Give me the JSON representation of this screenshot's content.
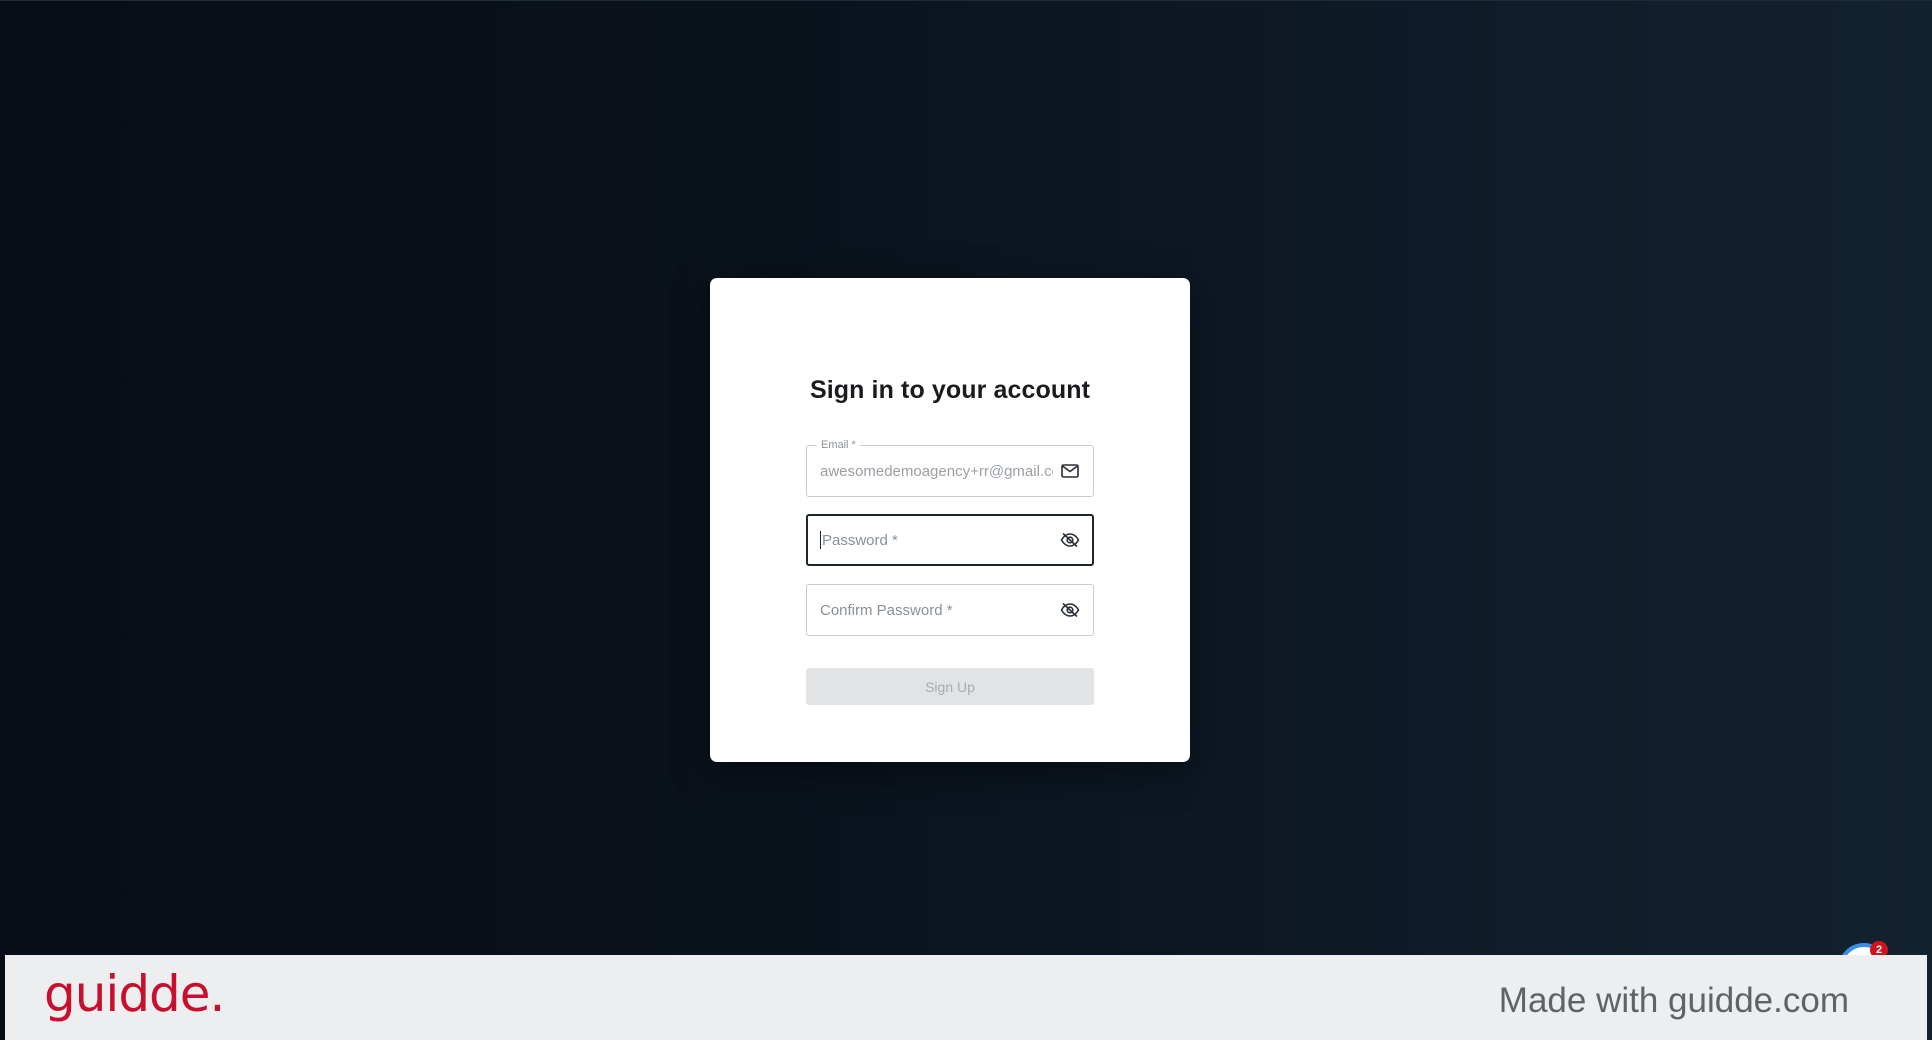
{
  "card": {
    "title": "Sign in to your account"
  },
  "email_field": {
    "label": "Email *",
    "value": "awesomedemoagency+rr@gmail.com",
    "icon": "mail-icon"
  },
  "password_field": {
    "placeholder": "Password *",
    "icon": "eye-off-icon"
  },
  "confirm_password_field": {
    "placeholder": "Confirm Password *",
    "icon": "eye-off-icon"
  },
  "signup_button": {
    "label": "Sign Up"
  },
  "footer": {
    "logo": "guidde.",
    "tagline": "Made with guidde.com"
  },
  "widget": {
    "badge_count": "2"
  },
  "colors": {
    "background_dark": "#080e17",
    "card": "#ffffff",
    "focus_border": "#1c2530",
    "disabled_button": "#e2e3e5",
    "brand_red": "#c8102e",
    "footer_bg": "#eceef0"
  }
}
